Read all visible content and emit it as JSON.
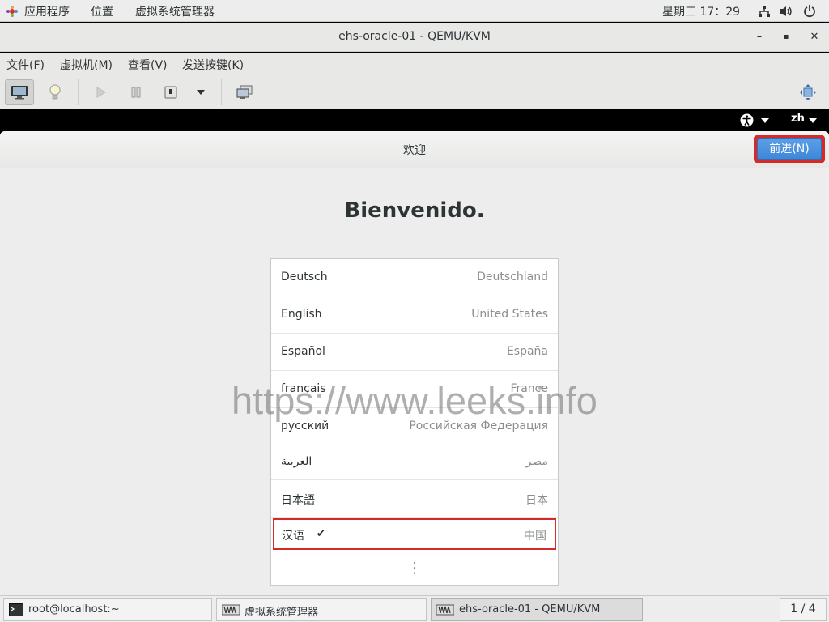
{
  "topbar": {
    "applications": "应用程序",
    "places": "位置",
    "active_app": "虚拟系统管理器",
    "clock": "星期三 17：29"
  },
  "window": {
    "title": "ehs-oracle-01 - QEMU/KVM",
    "minimize": "–",
    "maximize": "▪",
    "close": "✕"
  },
  "menubar": {
    "file": "文件(F)",
    "vm": "虚拟机(M)",
    "view": "查看(V)",
    "sendkey": "发送按键(K)"
  },
  "guest": {
    "topbar": {
      "keyboard_layout": "zh"
    },
    "header": {
      "title": "欢迎",
      "next_button": "前进(N)"
    },
    "welcome": "Bienvenido.",
    "languages": [
      {
        "name": "Deutsch",
        "country": "Deutschland"
      },
      {
        "name": "English",
        "country": "United States"
      },
      {
        "name": "Español",
        "country": "España"
      },
      {
        "name": "français",
        "country": "France"
      },
      {
        "name": "русский",
        "country": "Российская Федерация"
      },
      {
        "name": "العربية",
        "country": "مصر"
      },
      {
        "name": "日本語",
        "country": "日本"
      },
      {
        "name": "汉语",
        "country": "中国",
        "selected": true
      }
    ],
    "more_indicator": "⋮"
  },
  "watermark": "https://www.leeks.info",
  "taskbar": {
    "tasks": [
      {
        "label": "root@localhost:~",
        "icon": "terminal-icon"
      },
      {
        "label": "虚拟系统管理器",
        "icon": "virt-manager-icon"
      },
      {
        "label": "ehs-oracle-01 - QEMU/KVM",
        "icon": "virt-manager-icon",
        "active": true
      }
    ],
    "workspace": "1 / 4"
  },
  "colors": {
    "accent_blue": "#4a90d9",
    "highlight_red": "#d52a2a"
  }
}
